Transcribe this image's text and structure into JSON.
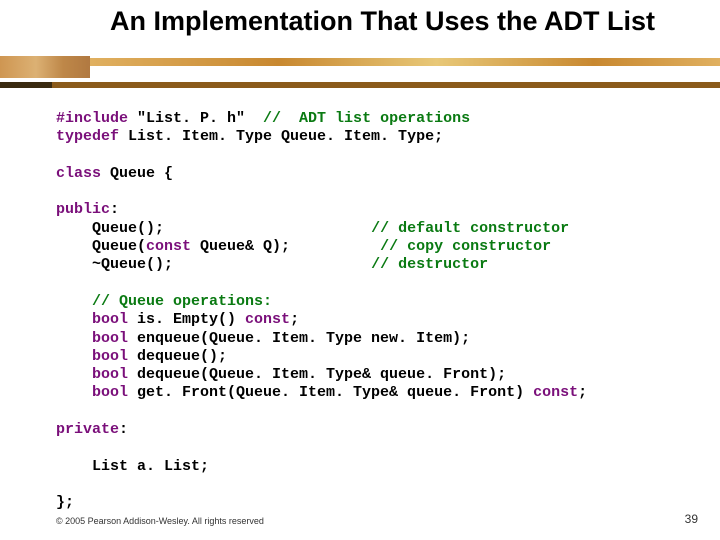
{
  "title": "An Implementation That Uses the ADT List",
  "code": {
    "l01a": "#include",
    "l01b": " \"List. P. h\"  ",
    "l01c": "//  ADT list operations",
    "l02a": "typedef",
    "l02b": " List. Item. Type Queue. Item. Type;",
    "l03a": "class",
    "l03b": " Queue {",
    "l04a": "public",
    "l04b": ":",
    "l05": "    Queue();                       ",
    "l05c": "// default constructor",
    "l06a": "    Queue(",
    "l06b": "const",
    "l06c": " Queue& Q);          ",
    "l06d": "// copy constructor",
    "l07": "    ~Queue();                      ",
    "l07c": "// destructor",
    "l08": "    ",
    "l08c": "// Queue operations:",
    "l09a": "    bool",
    "l09b": " is. Empty() ",
    "l09c": "const",
    "l09d": ";",
    "l10a": "    bool",
    "l10b": " enqueue(Queue. Item. Type new. Item);",
    "l11a": "    bool",
    "l11b": " dequeue();",
    "l12a": "    bool",
    "l12b": " dequeue(Queue. Item. Type& queue. Front);",
    "l13a": "    bool",
    "l13b": " get. Front(Queue. Item. Type& queue. Front) ",
    "l13c": "const",
    "l13d": ";",
    "l14a": "private",
    "l14b": ":",
    "l15": "    List a. List;",
    "l16": "};"
  },
  "footer": "© 2005 Pearson Addison-Wesley. All rights reserved",
  "pagenum": "39"
}
